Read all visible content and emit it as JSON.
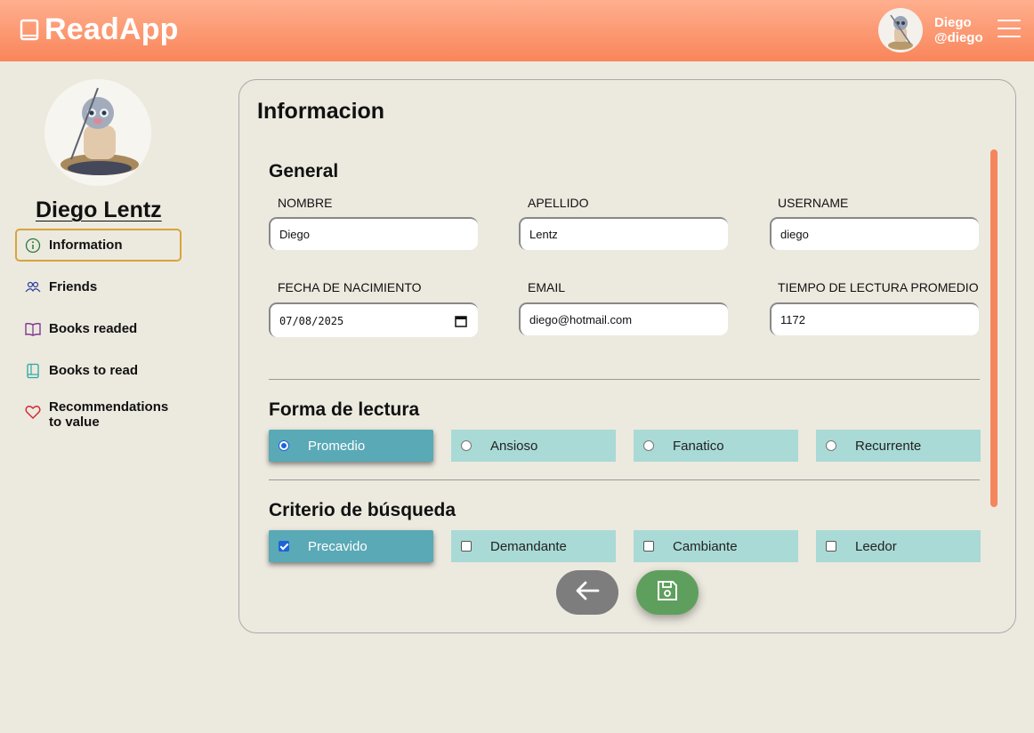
{
  "header": {
    "brand": "ReadApp",
    "user_name": "Diego",
    "user_handle": "@diego"
  },
  "profile": {
    "name": "Diego Lentz"
  },
  "sidebar": {
    "items": [
      {
        "label": "Information",
        "icon": "info-icon"
      },
      {
        "label": "Friends",
        "icon": "friends-icon"
      },
      {
        "label": "Books readed",
        "icon": "open-book-icon"
      },
      {
        "label": "Books to read",
        "icon": "book-icon"
      },
      {
        "label_line1": "Recommendations",
        "label_line2": "to value",
        "icon": "heart-icon"
      }
    ]
  },
  "main": {
    "title": "Informacion",
    "general": {
      "title": "General",
      "nombre_label": "NOMBRE",
      "nombre": "Diego",
      "apellido_label": "APELLIDO",
      "apellido": "Lentz",
      "username_label": "USERNAME",
      "username": "diego",
      "fecha_label": "FECHA DE NACIMIENTO",
      "fecha": "07/08/2025",
      "email_label": "EMAIL",
      "email": "diego@hotmail.com",
      "tiempo_label": "TIEMPO DE LECTURA PROMEDIO",
      "tiempo": "1172"
    },
    "forma": {
      "title": "Forma de lectura",
      "options": [
        "Promedio",
        "Ansioso",
        "Fanatico",
        "Recurrente"
      ],
      "selected": "Promedio"
    },
    "criterio": {
      "title": "Criterio de búsqueda",
      "options": [
        "Precavido",
        "Demandante",
        "Cambiante",
        "Leedor"
      ],
      "checked": [
        "Precavido"
      ]
    }
  },
  "colors": {
    "header_start": "#ffaf8e",
    "header_end": "#f9855a",
    "option_bg": "#a9dad6",
    "option_selected": "#5aa9b6",
    "active_border": "#d6a53b",
    "save_button": "#5f9f5e",
    "back_button": "#7d7d7d"
  }
}
